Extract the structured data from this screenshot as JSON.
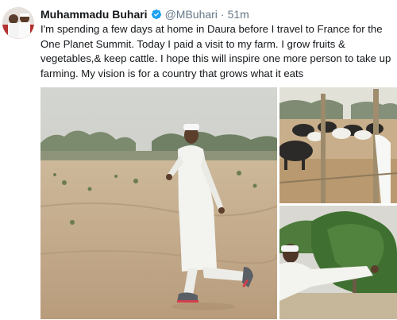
{
  "tweet": {
    "author_name": "Muhammadu Buhari",
    "handle": "@MBuhari",
    "separator": "·",
    "time": "51m",
    "verified": true,
    "verified_icon": "verified-badge-icon",
    "text": "I'm spending a few days at home in Daura before I travel to France for the One Planet Summit. Today I paid a visit to my farm. I grow fruits & vegetables,& keep cattle. I hope this will inspire one more person to take up farming. My vision is for a country that grows what it eats"
  },
  "colors": {
    "name": "#14171a",
    "meta": "#657786",
    "verified": "#1da1f2"
  }
}
